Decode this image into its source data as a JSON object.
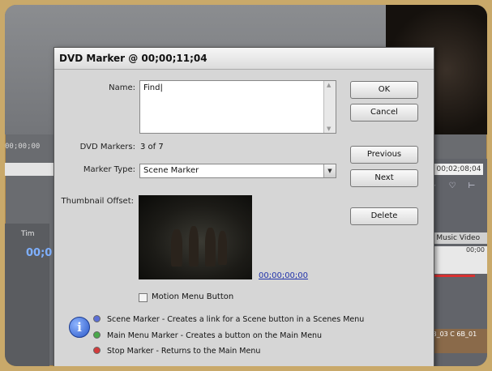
{
  "background": {
    "timecode_left": "00;00;00",
    "timecode_right": "00;02;08;04",
    "left_tab": "Tim",
    "left_timecode": "00;0",
    "right_tab": "e Music Video",
    "right_ruler": "00;00",
    "clip_label": "6B_03 C 6B_01"
  },
  "dialog": {
    "title": "DVD Marker @ 00;00;11;04",
    "name_label": "Name:",
    "name_value": "Find",
    "dvd_markers_label": "DVD Markers:",
    "dvd_markers_value": "3 of 7",
    "marker_type_label": "Marker Type:",
    "marker_type_value": "Scene Marker",
    "thumbnail_offset_label": "Thumbnail Offset:",
    "thumbnail_time": "00;00;00;00",
    "motion_menu_label": "Motion Menu Button",
    "motion_menu_checked": false,
    "buttons": {
      "ok": "OK",
      "cancel": "Cancel",
      "previous": "Previous",
      "next": "Next",
      "delete": "Delete"
    },
    "legend": [
      {
        "text": "Scene Marker - Creates a link for a Scene button in a Scenes Menu",
        "color": "#5b6fd6"
      },
      {
        "text": "Main Menu Marker - Creates a button on the Main Menu",
        "color": "#4aa84a"
      },
      {
        "text": "Stop Marker - Returns to the Main Menu",
        "color": "#d23b3b"
      }
    ]
  }
}
